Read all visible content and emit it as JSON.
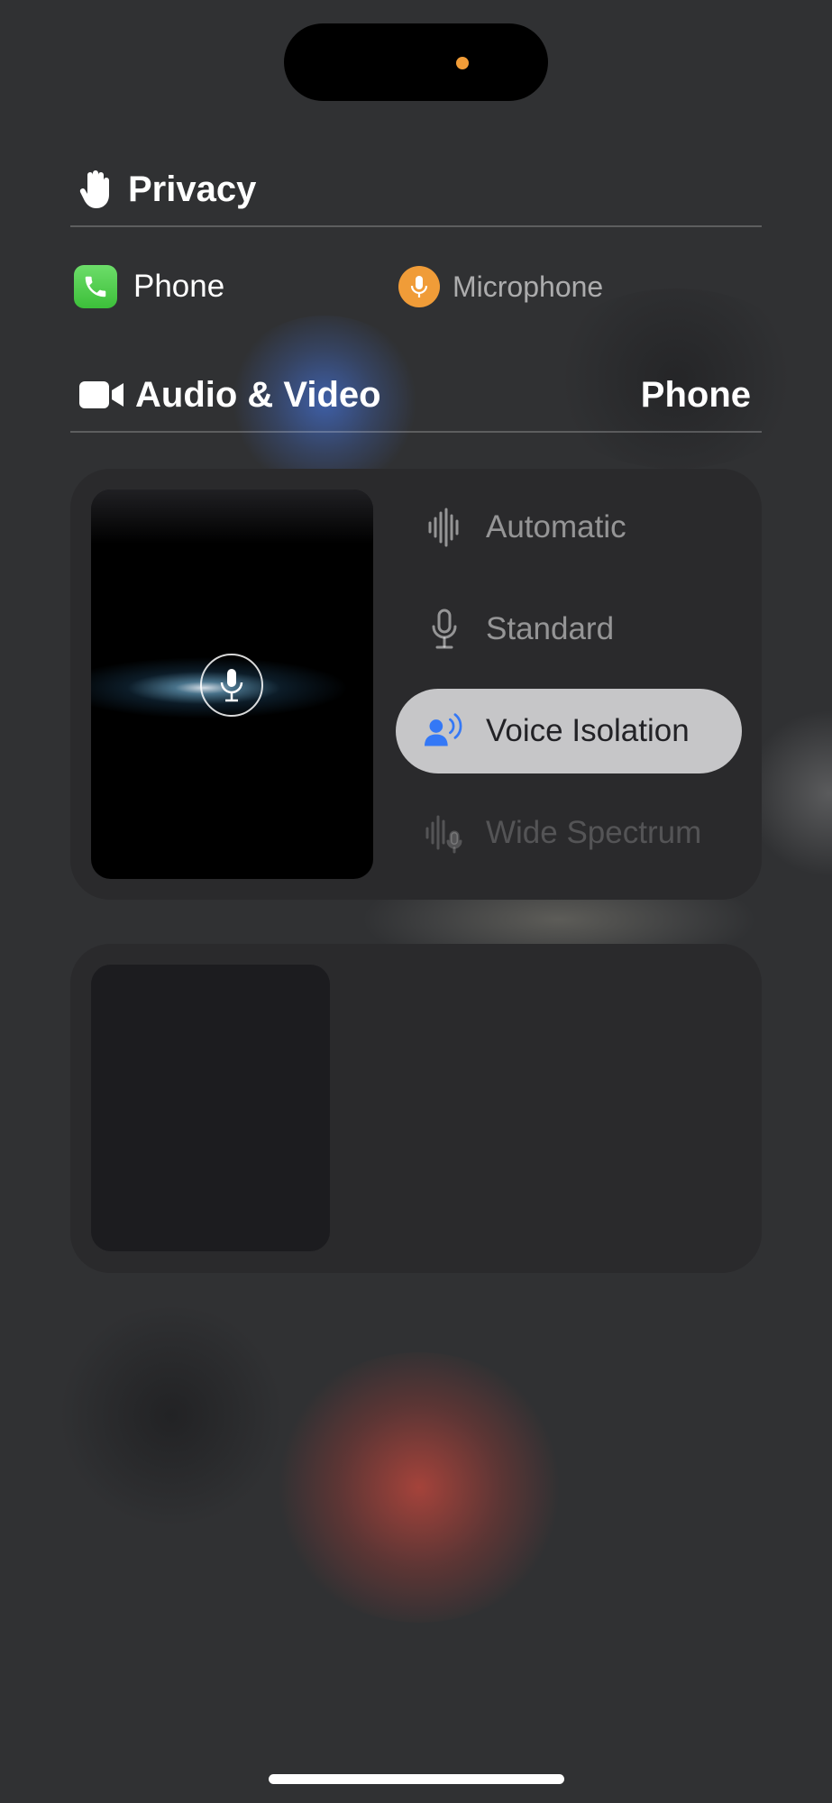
{
  "privacy": {
    "title": "Privacy"
  },
  "usage": [
    {
      "label": "Phone",
      "icon": "phone-icon"
    },
    {
      "label": "Microphone",
      "icon": "microphone-icon",
      "color": "#f09c38"
    }
  ],
  "audio_video": {
    "title": "Audio & Video",
    "app": "Phone"
  },
  "mic_modes": [
    {
      "label": "Automatic",
      "icon": "waveform-icon",
      "state": "normal"
    },
    {
      "label": "Standard",
      "icon": "microphone-icon",
      "state": "normal"
    },
    {
      "label": "Voice Isolation",
      "icon": "person-wave-icon",
      "state": "selected"
    },
    {
      "label": "Wide Spectrum",
      "icon": "waveform-mic-icon",
      "state": "disabled"
    }
  ],
  "colors": {
    "accent_blue": "#3478f6",
    "mic_orange": "#f09c38",
    "indicator_dot": "#f29d38",
    "phone_green": "#4cd04a"
  }
}
